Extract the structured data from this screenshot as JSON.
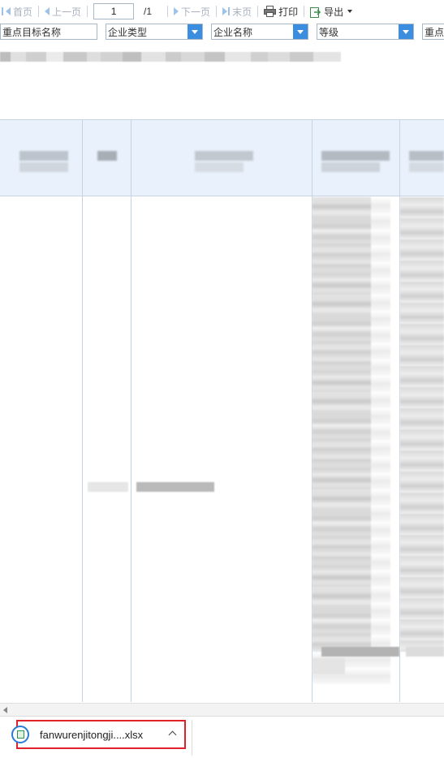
{
  "toolbar": {
    "first_page": "首页",
    "prev_page": "上一页",
    "page_value": "1",
    "page_total": "/1",
    "next_page": "下一页",
    "last_page": "末页",
    "print": "打印",
    "export": "导出"
  },
  "filters": {
    "target_name": "重点目标名称",
    "enterprise_type": "企业类型",
    "enterprise_name": "企业名称",
    "grade": "等级",
    "target_name_2": "重点"
  },
  "download": {
    "file_name": "fanwurenjitongji....xlsx"
  },
  "colors": {
    "accent": "#3b8de0",
    "header_bg": "#e8f1fc",
    "highlight_border": "#e0202a"
  }
}
